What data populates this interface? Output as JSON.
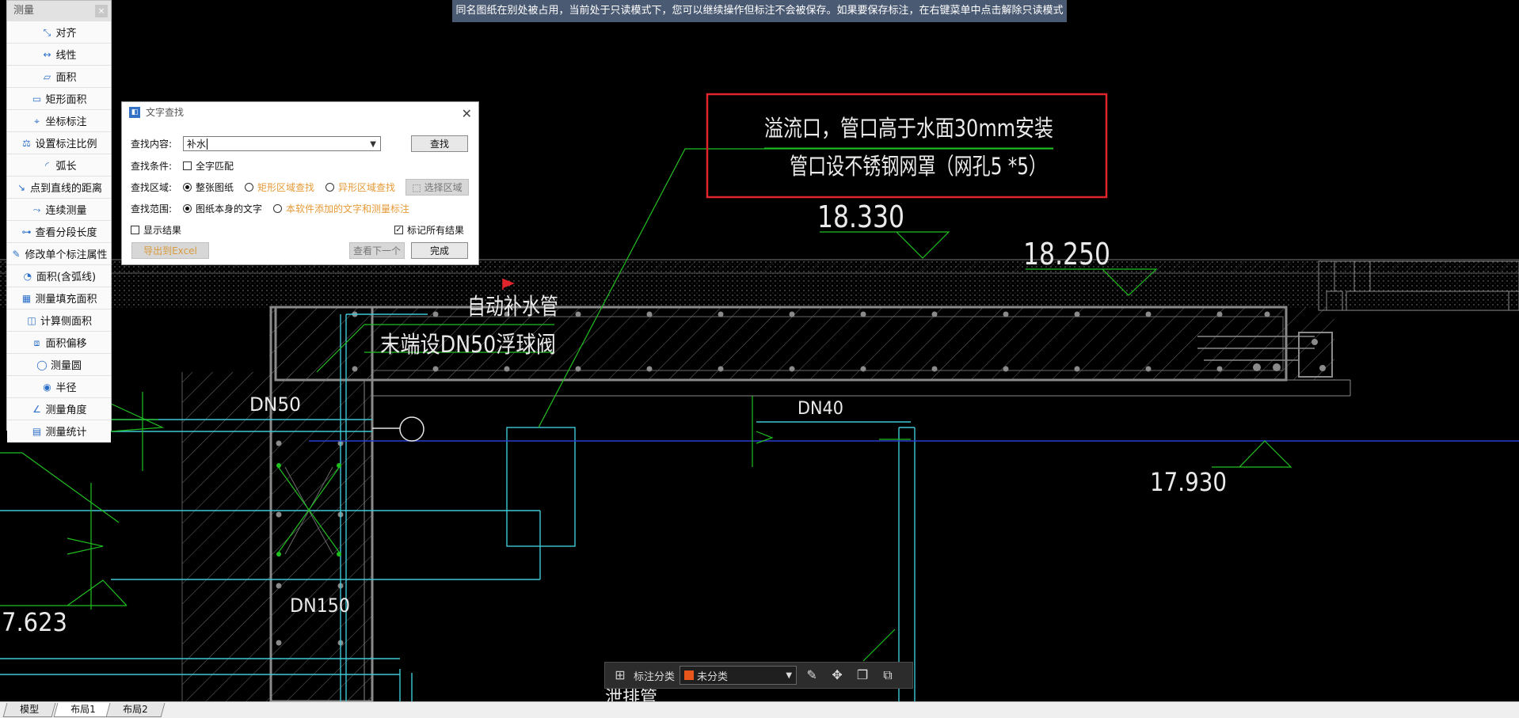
{
  "banner": {
    "text": "同名图纸在别处被占用，当前处于只读模式下，您可以继续操作但标注不会被保存。如果要保存标注，在右键菜单中点击解除只读模式"
  },
  "measure": {
    "title": "测量",
    "items": [
      {
        "label": "对齐",
        "icon": "align-dim-icon"
      },
      {
        "label": "线性",
        "icon": "linear-dim-icon"
      },
      {
        "label": "面积",
        "icon": "area-icon"
      },
      {
        "label": "矩形面积",
        "icon": "rect-area-icon"
      },
      {
        "label": "坐标标注",
        "icon": "coordinate-icon"
      },
      {
        "label": "设置标注比例",
        "icon": "scale-icon"
      },
      {
        "label": "弧长",
        "icon": "arc-icon"
      },
      {
        "label": "点到直线的距离",
        "icon": "point-line-icon"
      },
      {
        "label": "连续测量",
        "icon": "continuous-icon"
      },
      {
        "label": "查看分段长度",
        "icon": "segment-icon"
      },
      {
        "label": "修改单个标注属性",
        "icon": "edit-dim-icon"
      },
      {
        "label": "面积(含弧线)",
        "icon": "arc-area-icon"
      },
      {
        "label": "测量填充面积",
        "icon": "hatch-area-icon"
      },
      {
        "label": "计算侧面积",
        "icon": "side-area-icon"
      },
      {
        "label": "面积偏移",
        "icon": "offset-area-icon"
      },
      {
        "label": "测量圆",
        "icon": "circle-icon"
      },
      {
        "label": "半径",
        "icon": "radius-icon"
      },
      {
        "label": "测量角度",
        "icon": "angle-icon"
      },
      {
        "label": "测量统计",
        "icon": "stats-icon"
      }
    ]
  },
  "dialog": {
    "title": "文字查找",
    "content_label": "查找内容:",
    "content_value": "补水",
    "find_button": "查找",
    "condition_label": "查找条件:",
    "full_match": "全字匹配",
    "area_label": "查找区域:",
    "area_options": [
      "整张图纸",
      "矩形区域查找",
      "异形区域查找"
    ],
    "select_area_button": "选择区域",
    "range_label": "查找范围:",
    "range_options": [
      "图纸本身的文字",
      "本软件添加的文字和测量标注"
    ],
    "show_results": "显示结果",
    "mark_all": "标记所有结果",
    "export_button": "导出到Excel",
    "next_button": "查看下一个",
    "done_button": "完成"
  },
  "drawing": {
    "note_line1": "溢流口，管口高于水面30mm安装",
    "note_line2": "管口设不锈钢网罩（网孔5 *5）",
    "elev_18330": "18.330",
    "elev_18250": "18.250",
    "elev_17930": "17.930",
    "elev_7623": "7.623",
    "text_auto_pipe": "自动补水管",
    "text_float_valve": "末端设DN50浮球阀",
    "dn50": "DN50",
    "dn40": "DN40",
    "dn150": "DN150",
    "text_bottom": "泄排管"
  },
  "annot_bar": {
    "label": "标注分类",
    "category": "未分类",
    "category_color": "#e8561b"
  },
  "tabs": [
    "模型",
    "布局1",
    "布局2"
  ]
}
